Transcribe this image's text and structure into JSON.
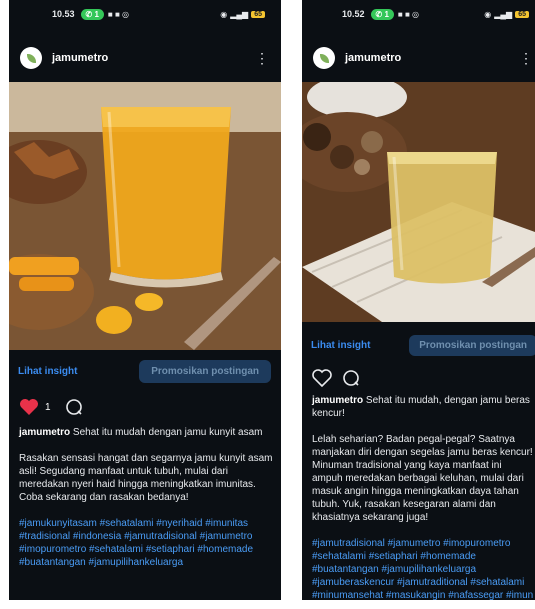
{
  "screens": [
    {
      "status": {
        "time": "10.53",
        "pill": "1",
        "battery": "65"
      },
      "account": "jamumetro",
      "insight_label": "Lihat insight",
      "promote_label": "Promosikan postingan",
      "like_count": "1",
      "caption_user": "jamumetro",
      "caption_title": "Sehat itu mudah dengan jamu kunyit asam",
      "caption_body": "Rasakan sensasi hangat dan segarnya jamu kunyit asam asli! Segudang manfaat untuk tubuh, mulai dari meredakan nyeri haid hingga meningkatkan imunitas. Coba sekarang dan rasakan bedanya!",
      "hashtags": "#jamukunyitasam #sehatalami #nyerihaid #imunitas #tradisional #indonesia #jamutradisional #jamumetro #imopurometro #sehatalami #setiaphari #homemade #buatantangan #jamupilihankeluarga"
    },
    {
      "status": {
        "time": "10.52",
        "pill": "1",
        "battery": "65"
      },
      "account": "jamumetro",
      "insight_label": "Lihat insight",
      "promote_label": "Promosikan postingan",
      "caption_user": "jamumetro",
      "caption_title": "Sehat itu mudah, dengan jamu beras kencur!",
      "caption_body": "Lelah seharian? Badan pegal-pegal? Saatnya manjakan diri dengan segelas jamu beras kencur! Minuman tradisional yang kaya manfaat ini ampuh meredakan berbagai keluhan, mulai dari masuk angin hingga meningkatkan daya tahan tubuh. Yuk, rasakan kesegaran alami dan khasiatnya sekarang juga!",
      "hashtags": "#jamutradisional #jamumetro #imopurometro #sehatalami #setiaphari #homemade #buatantangan #jamupilihankeluarga #jamuberaskencur #jamutraditional #sehatalami #minumansehat #masukangin #nafassegar #imun #kesehatan #hidupsehat #indonesia"
    }
  ],
  "colors": {
    "background": "#0b0f14",
    "link": "#3b8cf0",
    "hashtag": "#4a9cf5",
    "promote_bg": "#1d3a5c",
    "like": "#e8324a",
    "pill": "#34c759"
  },
  "icons": [
    "heart-icon",
    "comment-icon",
    "more-options-icon",
    "avatar-leaf-icon",
    "wifi-icon",
    "signal-icon",
    "battery-icon"
  ]
}
